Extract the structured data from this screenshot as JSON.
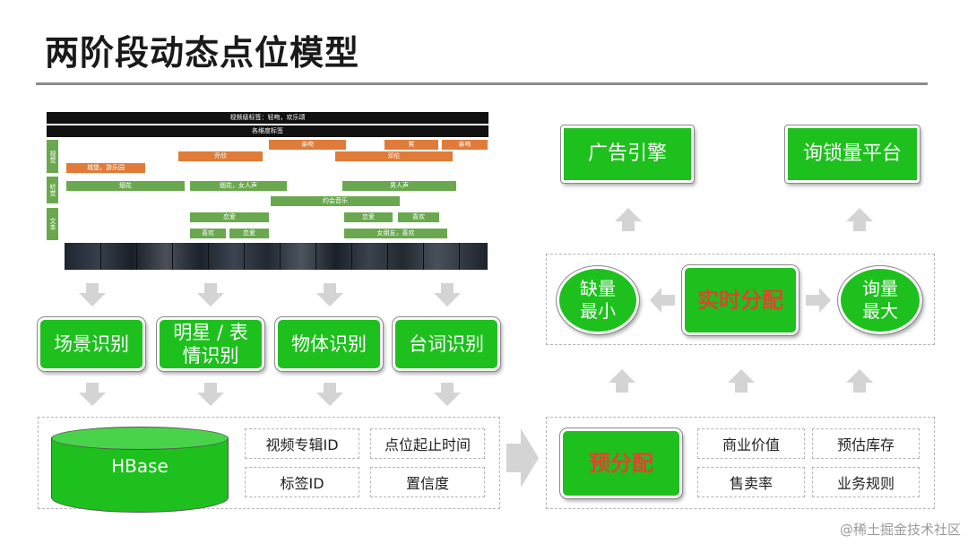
{
  "page": {
    "title": "两阶段动态点位模型"
  },
  "timeline": {
    "header_top": "视频级标签：轻吻，欢乐颂",
    "header_sub": "各维度标签",
    "row_labels": {
      "visual": "视觉",
      "audio": "听觉",
      "text": "文本"
    },
    "segments": {
      "v1": "亲吻",
      "v2": "笑",
      "v3": "亲吻",
      "v4": "乔欣",
      "v5": "邓伦",
      "v6": "城堡，游乐园",
      "a1": "烟花",
      "a2": "烟花，女人声",
      "a3": "男人声",
      "a4": "约会音乐",
      "t1": "恋爱",
      "t2": "恋爱",
      "t3": "喜欢",
      "t4": "喜欢",
      "t5": "恋爱",
      "t6": "女朋友，喜欢"
    }
  },
  "left": {
    "boxes": [
      "场景识别",
      "明星 / 表情识别",
      "物体识别",
      "台词识别"
    ],
    "box2_line1": "明星 / 表",
    "box2_line2": "情识别",
    "hbase": "HBase",
    "fields": [
      "视频专辑ID",
      "点位起止时间",
      "标签ID",
      "置信度"
    ]
  },
  "right": {
    "top_boxes": [
      "广告引擎",
      "询锁量平台"
    ],
    "realtime": "实时分配",
    "left_oval_line1": "缺量",
    "left_oval_line2": "最小",
    "right_oval_line1": "询量",
    "right_oval_line2": "最大",
    "pre_alloc": "预分配",
    "factors": [
      "商业价值",
      "预估库存",
      "售卖率",
      "业务规则"
    ]
  },
  "watermark": "@稀土掘金技术社区",
  "colors": {
    "green": "#1ec01e",
    "orange": "#e07b39",
    "label_green": "#6aa84f",
    "red_text": "#e0442c",
    "arrow_gray": "#d4d4d4"
  }
}
